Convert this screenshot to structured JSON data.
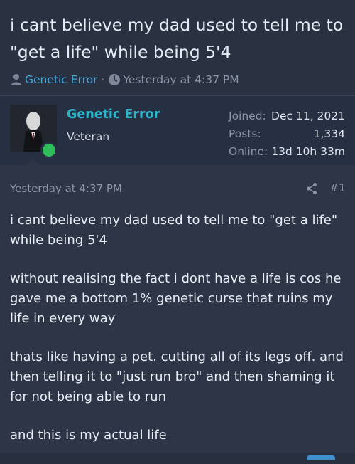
{
  "thread": {
    "title": "i cant believe my dad used to tell me to \"get a life\" while being 5'4",
    "author": "Genetic Error",
    "separator": "·",
    "timestamp": "Yesterday at 4:37 PM"
  },
  "user": {
    "name": "Genetic Error",
    "title": "Veteran",
    "stats": [
      {
        "label": "Joined:",
        "value": "Dec 11, 2021"
      },
      {
        "label": "Posts:",
        "value": "1,334"
      },
      {
        "label": "Online:",
        "value": "13d 10h 33m"
      }
    ]
  },
  "post": {
    "date": "Yesterday at 4:37 PM",
    "number": "#1",
    "paragraphs": [
      "i cant believe my dad used to tell me to \"get a life\" while being 5'4",
      "without realising the fact i dont have a life is cos he gave me a bottom 1% genetic curse that ruins my life in every way",
      "thats like having a pet. cutting all of its legs off. and then telling it to \"just run bro\" and then shaming it for not being able to run",
      "and this is my actual life"
    ]
  },
  "colors": {
    "background": "#283040",
    "post_background": "#2e3547",
    "username": "#2fb3c8",
    "author_link": "#49a7dc",
    "online": "#2fbd5a"
  },
  "icons": {
    "author": "user-icon",
    "time": "clock-icon",
    "share": "share-icon",
    "online": "online-status-icon"
  }
}
